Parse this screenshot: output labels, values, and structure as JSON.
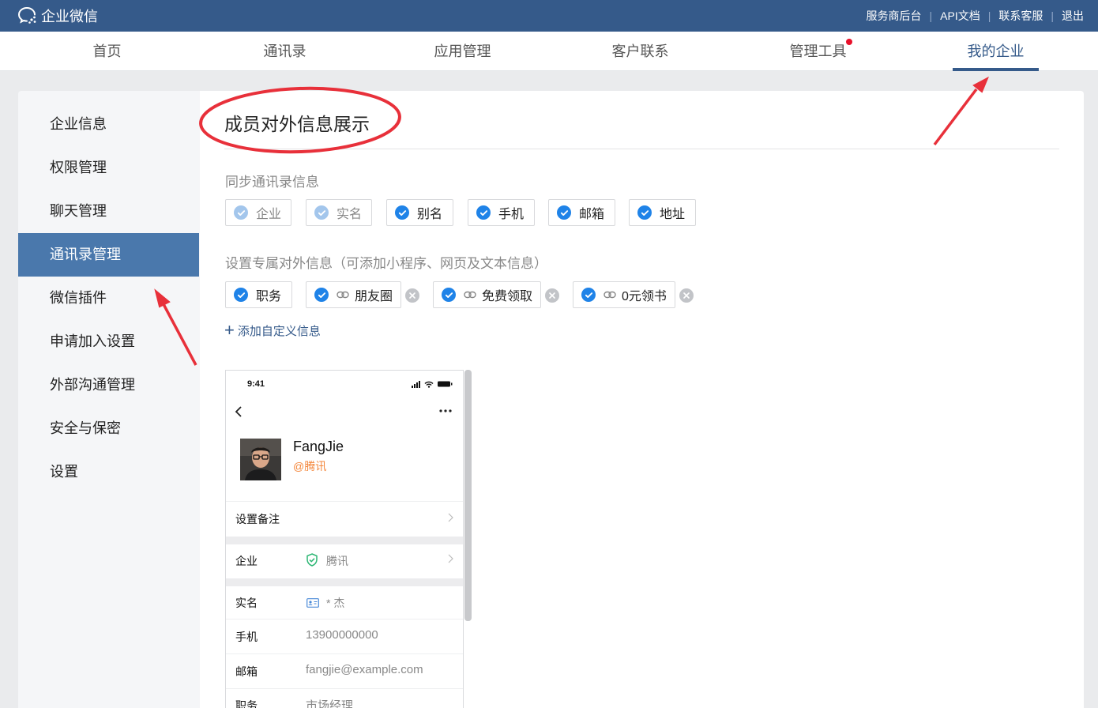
{
  "app": {
    "logo_text": "企业微信"
  },
  "top_links": [
    "服务商后台",
    "API文档",
    "联系客服",
    "退出"
  ],
  "nav": [
    {
      "label": "首页",
      "active": false
    },
    {
      "label": "通讯录",
      "active": false
    },
    {
      "label": "应用管理",
      "active": false
    },
    {
      "label": "客户联系",
      "active": false
    },
    {
      "label": "管理工具",
      "active": false,
      "badge": "red-dot"
    },
    {
      "label": "我的企业",
      "active": true
    }
  ],
  "sidebar": [
    {
      "label": "企业信息"
    },
    {
      "label": "权限管理"
    },
    {
      "label": "聊天管理"
    },
    {
      "label": "通讯录管理",
      "active": true
    },
    {
      "label": "微信插件"
    },
    {
      "label": "申请加入设置"
    },
    {
      "label": "外部沟通管理"
    },
    {
      "label": "安全与保密"
    },
    {
      "label": "设置"
    }
  ],
  "main": {
    "title": "成员对外信息展示",
    "sync_label": "同步通讯录信息",
    "sync_chips": [
      {
        "label": "企业",
        "checked": true,
        "disabled": true
      },
      {
        "label": "实名",
        "checked": true,
        "disabled": true
      },
      {
        "label": "别名",
        "checked": true,
        "disabled": false
      },
      {
        "label": "手机",
        "checked": true,
        "disabled": false
      },
      {
        "label": "邮箱",
        "checked": true,
        "disabled": false
      },
      {
        "label": "地址",
        "checked": true,
        "disabled": false
      }
    ],
    "custom_label": "设置专属对外信息（可添加小程序、网页及文本信息）",
    "custom_chips": [
      {
        "label": "职务",
        "checked": true,
        "link": false,
        "removable": false
      },
      {
        "label": "朋友圈",
        "checked": true,
        "link": true,
        "removable": true
      },
      {
        "label": "免费领取",
        "checked": true,
        "link": true,
        "removable": true
      },
      {
        "label": "0元领书",
        "checked": true,
        "link": true,
        "removable": true
      }
    ],
    "add_label": "添加自定义信息"
  },
  "preview": {
    "time": "9:41",
    "name": "FangJie",
    "org": "@腾讯",
    "remark_label": "设置备注",
    "rows": [
      {
        "label": "企业",
        "value": "腾讯"
      },
      {
        "label": "实名",
        "value": "* 杰"
      },
      {
        "label": "手机",
        "value": "13900000000"
      },
      {
        "label": "邮箱",
        "value": "fangjie@example.com"
      },
      {
        "label": "职务",
        "value": "市场经理"
      }
    ]
  },
  "colors": {
    "topbar": "#355a8a",
    "active_side": "#4a78ac",
    "check": "#1f83e8",
    "annotation": "#e8303a",
    "org_orange": "#f4863a"
  }
}
